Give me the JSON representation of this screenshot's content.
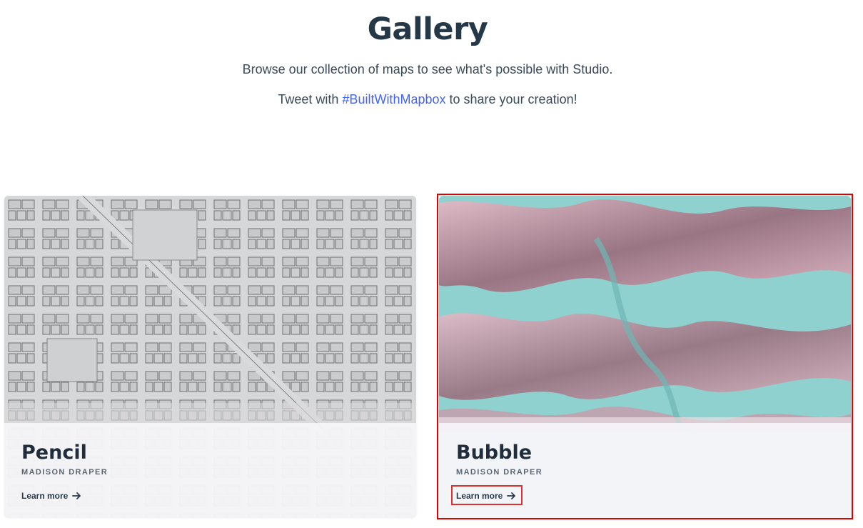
{
  "page": {
    "title": "Gallery",
    "subtitle": "Browse our collection of maps to see what's possible with Studio.",
    "tweet_prefix": "Tweet with ",
    "tweet_hashtag": "#BuiltWithMapbox",
    "tweet_suffix": " to share your creation!"
  },
  "colors": {
    "title": "#253848",
    "link": "#4264fb",
    "highlight": "#e00000"
  },
  "cards": [
    {
      "title": "Pencil",
      "author": "MADISON DRAPER",
      "learn_more": "Learn more",
      "icon": "arrow-right-icon"
    },
    {
      "title": "Bubble",
      "author": "MADISON DRAPER",
      "learn_more": "Learn more",
      "icon": "arrow-right-icon"
    }
  ]
}
